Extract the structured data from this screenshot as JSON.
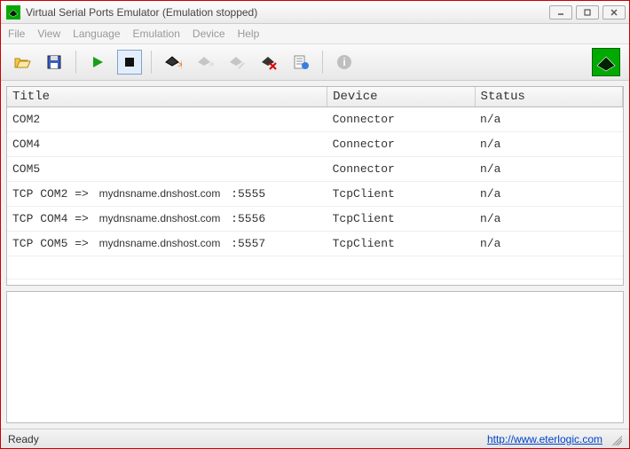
{
  "window": {
    "title": "Virtual Serial Ports Emulator (Emulation stopped)"
  },
  "menu": {
    "file": "File",
    "view": "View",
    "language": "Language",
    "emulation": "Emulation",
    "device": "Device",
    "help": "Help"
  },
  "table": {
    "headers": {
      "title": "Title",
      "device": "Device",
      "status": "Status"
    },
    "rows": [
      {
        "title_pre": "COM2",
        "title_host": "",
        "title_post": "",
        "device": "Connector",
        "status": "n/a"
      },
      {
        "title_pre": "COM4",
        "title_host": "",
        "title_post": "",
        "device": "Connector",
        "status": "n/a"
      },
      {
        "title_pre": "COM5",
        "title_host": "",
        "title_post": "",
        "device": "Connector",
        "status": "n/a"
      },
      {
        "title_pre": "TCP COM2 => ",
        "title_host": "mydnsname.dnshost.com",
        "title_post": " :5555",
        "device": "TcpClient",
        "status": "n/a"
      },
      {
        "title_pre": "TCP COM4 => ",
        "title_host": "mydnsname.dnshost.com",
        "title_post": " :5556",
        "device": "TcpClient",
        "status": "n/a"
      },
      {
        "title_pre": "TCP COM5 => ",
        "title_host": "mydnsname.dnshost.com",
        "title_post": " :5557",
        "device": "TcpClient",
        "status": "n/a"
      }
    ]
  },
  "status": {
    "text": "Ready",
    "link": "http://www.eterlogic.com"
  }
}
